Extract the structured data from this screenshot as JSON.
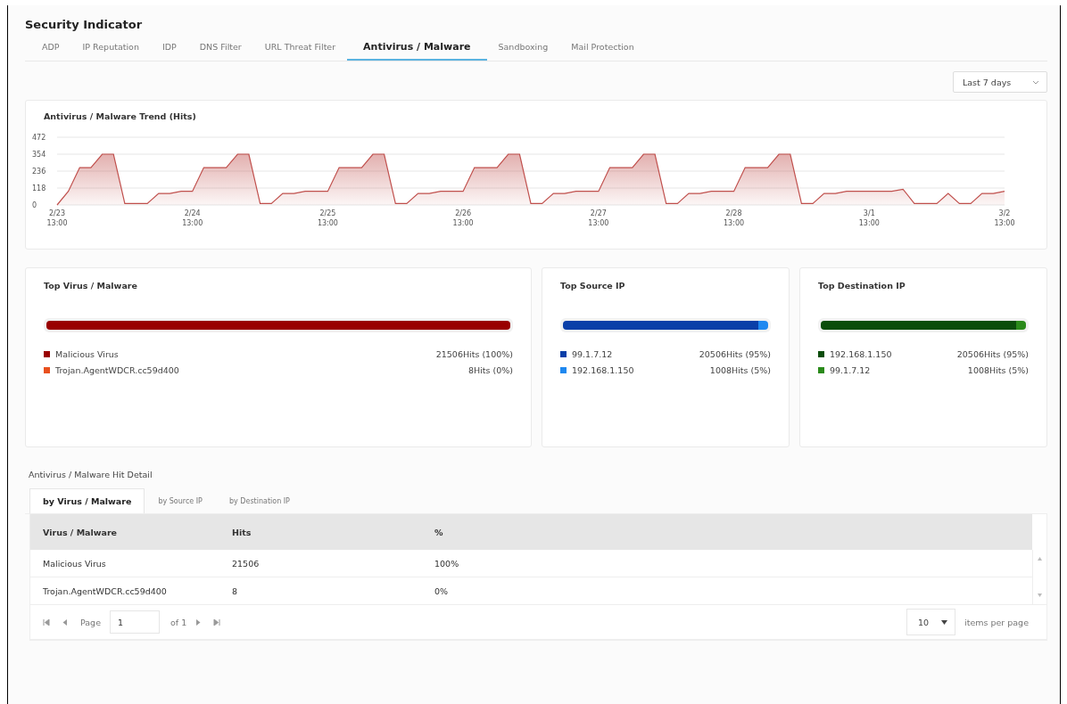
{
  "page_title": "Security Indicator",
  "tabs": [
    {
      "label": "ADP",
      "selected": false
    },
    {
      "label": "IP Reputation",
      "selected": false
    },
    {
      "label": "IDP",
      "selected": false
    },
    {
      "label": "DNS Filter",
      "selected": false
    },
    {
      "label": "URL Threat Filter",
      "selected": false
    },
    {
      "label": "Antivirus / Malware",
      "selected": true
    },
    {
      "label": "Sandboxing",
      "selected": false
    },
    {
      "label": "Mail Protection",
      "selected": false
    }
  ],
  "range_select": {
    "value": "Last 7 days"
  },
  "trend": {
    "title": "Antivirus / Malware Trend (Hits)",
    "chart_data": {
      "type": "area",
      "categories": [
        "2/23 13:00",
        null,
        null,
        null,
        null,
        null,
        null,
        null,
        null,
        null,
        null,
        null,
        "2/24 13:00",
        null,
        null,
        null,
        null,
        null,
        null,
        null,
        null,
        null,
        null,
        null,
        "2/25 13:00",
        null,
        null,
        null,
        null,
        null,
        null,
        null,
        null,
        null,
        null,
        null,
        "2/26 13:00",
        null,
        null,
        null,
        null,
        null,
        null,
        null,
        null,
        null,
        null,
        null,
        "2/27 13:00",
        null,
        null,
        null,
        null,
        null,
        null,
        null,
        null,
        null,
        null,
        null,
        "2/28 13:00",
        null,
        null,
        null,
        null,
        null,
        null,
        null,
        null,
        null,
        null,
        null,
        "3/1 13:00",
        null,
        null,
        null,
        null,
        null,
        null,
        null,
        null,
        null,
        null,
        null,
        "3/2 13:00"
      ],
      "values": [
        0,
        95,
        260,
        260,
        354,
        354,
        10,
        10,
        10,
        80,
        80,
        95,
        95,
        260,
        260,
        260,
        354,
        354,
        10,
        10,
        80,
        80,
        95,
        95,
        95,
        260,
        260,
        260,
        354,
        354,
        10,
        10,
        80,
        80,
        95,
        95,
        95,
        260,
        260,
        260,
        354,
        354,
        10,
        10,
        80,
        80,
        95,
        95,
        95,
        260,
        260,
        260,
        354,
        354,
        10,
        10,
        80,
        80,
        95,
        95,
        95,
        260,
        260,
        260,
        354,
        354,
        10,
        10,
        80,
        80,
        95,
        95,
        95,
        95,
        95,
        110,
        10,
        10,
        10,
        80,
        10,
        10,
        80,
        80,
        95
      ],
      "ylim": [
        0,
        472
      ],
      "yticks": [
        0,
        118,
        236,
        354,
        472
      ],
      "grid": true
    }
  },
  "top_cards": [
    {
      "title": "Top Virus / Malware",
      "items": [
        {
          "name": "Malicious Virus",
          "hits": "21506Hits (100%)",
          "color": "#990000",
          "level": 1
        },
        {
          "name": "Trojan.AgentWDCR.cc59d400",
          "hits": "8Hits (0%)",
          "color": "#e8501e"
        }
      ]
    },
    {
      "title": "Top Source IP",
      "items": [
        {
          "name": "99.1.7.12",
          "hits": "20506Hits (95%)",
          "color": "#0a3fa8",
          "level": 0.95
        },
        {
          "name": "192.168.1.150",
          "hits": "1008Hits (5%)",
          "color": "#1e88f0",
          "level": 0.05
        }
      ]
    },
    {
      "title": "Top Destination IP",
      "items": [
        {
          "name": "192.168.1.150",
          "hits": "20506Hits (95%)",
          "color": "#0b4d0b",
          "level": 0.95
        },
        {
          "name": "99.1.7.12",
          "hits": "1008Hits (5%)",
          "color": "#2a8a1a",
          "level": 0.05
        }
      ]
    }
  ],
  "detail": {
    "title": "Antivirus / Malware Hit Detail",
    "tabs": [
      {
        "label": "by Virus / Malware",
        "selected": true
      },
      {
        "label": "by Source IP",
        "selected": false
      },
      {
        "label": "by Destination IP",
        "selected": false
      }
    ],
    "table": {
      "columns": [
        "Virus / Malware",
        "Hits",
        "%"
      ],
      "rows": [
        [
          "Malicious Virus",
          "21506",
          "100%"
        ],
        [
          "Trojan.AgentWDCR.cc59d400",
          "8",
          "0%"
        ]
      ]
    },
    "pager": {
      "page_label": "Page",
      "page": "1",
      "of": "of 1",
      "per_page": "10",
      "per_page_label": "items per page"
    }
  }
}
